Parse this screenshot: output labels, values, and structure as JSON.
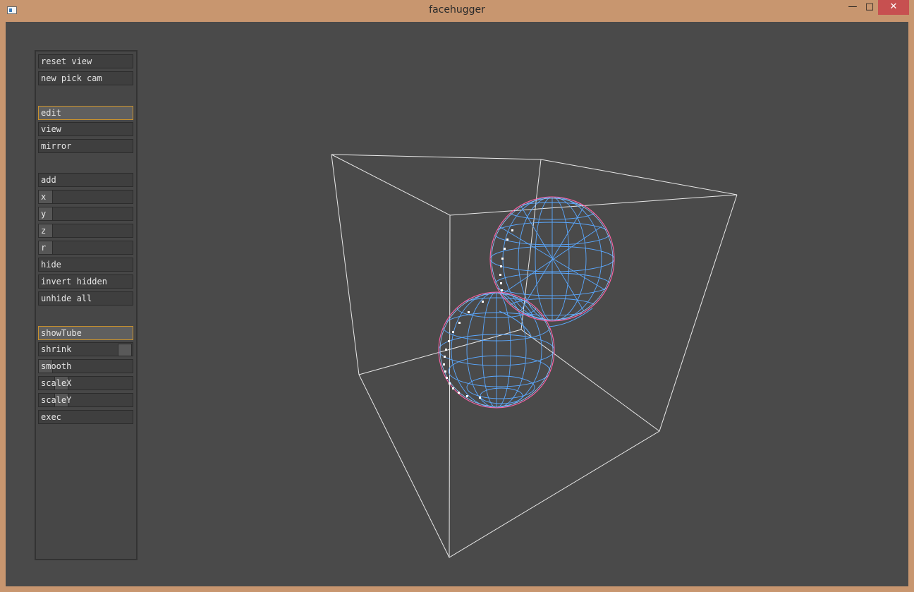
{
  "window": {
    "title": "facehugger",
    "minimize_label": "—",
    "maximize_label": "□",
    "close_label": "✕",
    "app_icon": "window-app-icon"
  },
  "panel": {
    "reset_view": "reset view",
    "new_pick_cam": "new pick cam",
    "edit": "edit",
    "view": "view",
    "mirror": "mirror",
    "add": "add",
    "x": "x",
    "y": "y",
    "z": "z",
    "r": "r",
    "hide": "hide",
    "invert_hidden": "invert hidden",
    "unhide_all": "unhide all",
    "show_tube": "showTube",
    "shrink": "shrink",
    "smooth": "smooth",
    "scale_x": "scaleX",
    "scale_y": "scaleY",
    "exec": "exec"
  },
  "state": {
    "edit_active": true,
    "show_tube_active": true
  },
  "colors": {
    "background": "#4a4a4a",
    "frame": "#c8966f",
    "close": "#c75050",
    "active_outline": "#c9912c",
    "wire": "#5aa8ff",
    "silhouette": "#ff5fa0",
    "box_lines": "#e8e8e8",
    "points": "#ffffff"
  }
}
